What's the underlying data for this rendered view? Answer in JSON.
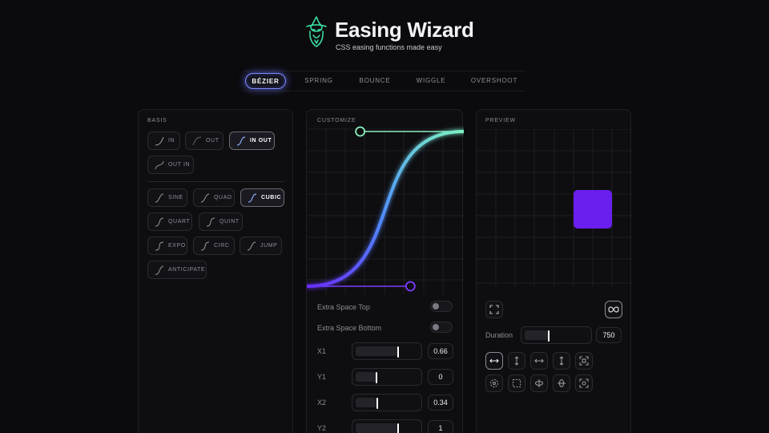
{
  "header": {
    "title": "Easing Wizard",
    "subtitle": "CSS easing functions made easy",
    "logo_icon": "wizard-icon"
  },
  "tabs": [
    {
      "label": "BÉZIER",
      "active": true
    },
    {
      "label": "SPRING",
      "active": false
    },
    {
      "label": "BOUNCE",
      "active": false
    },
    {
      "label": "WIGGLE",
      "active": false
    },
    {
      "label": "OVERSHOOT",
      "active": false
    }
  ],
  "basis": {
    "title": "BASIS",
    "directions": [
      {
        "label": "IN",
        "active": false
      },
      {
        "label": "OUT",
        "active": false
      },
      {
        "label": "IN OUT",
        "active": true
      },
      {
        "label": "OUT IN",
        "active": false
      }
    ],
    "curves": [
      {
        "label": "SINE",
        "active": false
      },
      {
        "label": "QUAD",
        "active": false
      },
      {
        "label": "CUBIC",
        "active": true
      },
      {
        "label": "QUART",
        "active": false
      },
      {
        "label": "QUINT",
        "active": false
      },
      {
        "label": "EXPO",
        "active": false
      },
      {
        "label": "CIRC",
        "active": false
      },
      {
        "label": "JUMP",
        "active": false
      },
      {
        "label": "ANTICIPATE",
        "active": false
      }
    ]
  },
  "customize": {
    "title": "CUSTOMIZE",
    "extra_space_top": {
      "label": "Extra Space Top",
      "on": false
    },
    "extra_space_bottom": {
      "label": "Extra Space Bottom",
      "on": false
    },
    "params": [
      {
        "label": "X1",
        "value": "0.66",
        "fraction": 0.66
      },
      {
        "label": "Y1",
        "value": "0",
        "fraction": 0.33
      },
      {
        "label": "X2",
        "value": "0.34",
        "fraction": 0.34
      },
      {
        "label": "Y2",
        "value": "1",
        "fraction": 0.66
      }
    ],
    "colors": {
      "curve_start": "#6a2cff",
      "curve_end": "#7af2c4",
      "handle_start": "#7b3cff",
      "handle_end": "#8ff0c0"
    }
  },
  "preview": {
    "title": "PREVIEW",
    "square_color": "#6a1fee",
    "fullscreen_icon": "fullscreen-icon",
    "loop_icon": "infinity-icon",
    "duration_label": "Duration",
    "duration_value": "750",
    "duration_fraction": 0.37,
    "animations_row1": [
      "move-horizontal-icon",
      "move-vertical-icon",
      "stretch-horizontal-icon",
      "stretch-vertical-icon",
      "scale-icon"
    ],
    "animations_row2": [
      "rotate-icon",
      "border-square-icon",
      "flip-horizontal-icon",
      "flip-vertical-icon",
      "zoom-icon"
    ]
  }
}
